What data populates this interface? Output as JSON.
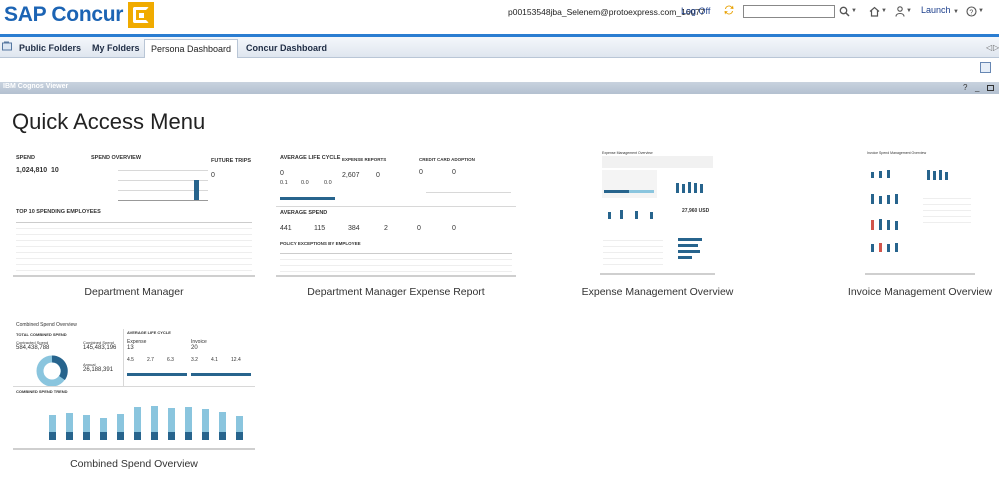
{
  "header": {
    "logo_text": "SAP Concur",
    "user": "p00153548jba_Selenem@protoexpress.com_16077",
    "logoff": "Log Off",
    "search_placeholder": "",
    "launch": "Launch"
  },
  "tabs": [
    {
      "label": "Public Folders"
    },
    {
      "label": "My Folders"
    },
    {
      "label": "Persona Dashboard"
    },
    {
      "label": "Concur Dashboard"
    }
  ],
  "viewer": {
    "title": "IBM Cognos Viewer",
    "help": "?",
    "minimize": "_"
  },
  "page_title": "Quick Access Menu",
  "tiles": [
    {
      "label": "Department Manager"
    },
    {
      "label": "Department Manager Expense Report"
    },
    {
      "label": "Expense Management Overview"
    },
    {
      "label": "Invoice Management Overview"
    },
    {
      "label": "Combined Spend Overview"
    }
  ],
  "thumbs": {
    "dm": {
      "spend": "SPEND",
      "spend_val": "1,024,810",
      "spend_left_val": "10",
      "spend_overview": "SPEND OVERVIEW",
      "future_trips": "FUTURE TRIPS",
      "future_trips_val": "0",
      "top10": "TOP 10 SPENDING EMPLOYEES"
    },
    "dmer": {
      "alc": "AVERAGE LIFE CYCLE",
      "alc_val1": "0",
      "alc_val2": "0.1",
      "alc_val3": "0.0",
      "alc_val4": "0.0",
      "expense_reports": "EXPENSE REPORTS",
      "er_val1": "2,607",
      "er_val2": "0",
      "cc_adoption": "CREDIT CARD ADOPTION",
      "cc_val1": "0",
      "cc_val2": "0",
      "avg_spend": "AVERAGE SPEND",
      "as_vals": [
        "441",
        "115",
        "384",
        "2",
        "0",
        "0"
      ],
      "policy": "POLICY EXCEPTIONS BY EMPLOYEE"
    },
    "emo": {
      "title": "Expense Management Overview",
      "val": "27,960 USD"
    },
    "imo": {
      "title": "Invoice Spend Management Overview"
    },
    "cso": {
      "title": "Combined Spend Overview",
      "total": "TOTAL COMBINED SPEND",
      "contract_label": "Contracted Spend",
      "contract_val": "584,438,788",
      "combined_label": "Combined Spend",
      "combined_val": "145,483,196",
      "annual_label": "Annual",
      "annual_val": "26,188,391",
      "alc": "AVERAGE LIFE CYCLE",
      "expense_label": "Expense",
      "expense_val": "13",
      "invoice_label": "Invoice",
      "invoice_val": "20",
      "e_vals": [
        "4.5",
        "2.7",
        "6.3"
      ],
      "i_vals": [
        "3.2",
        "4.1",
        "12.4"
      ],
      "trend": "COMBINED SPEND TREND"
    }
  }
}
